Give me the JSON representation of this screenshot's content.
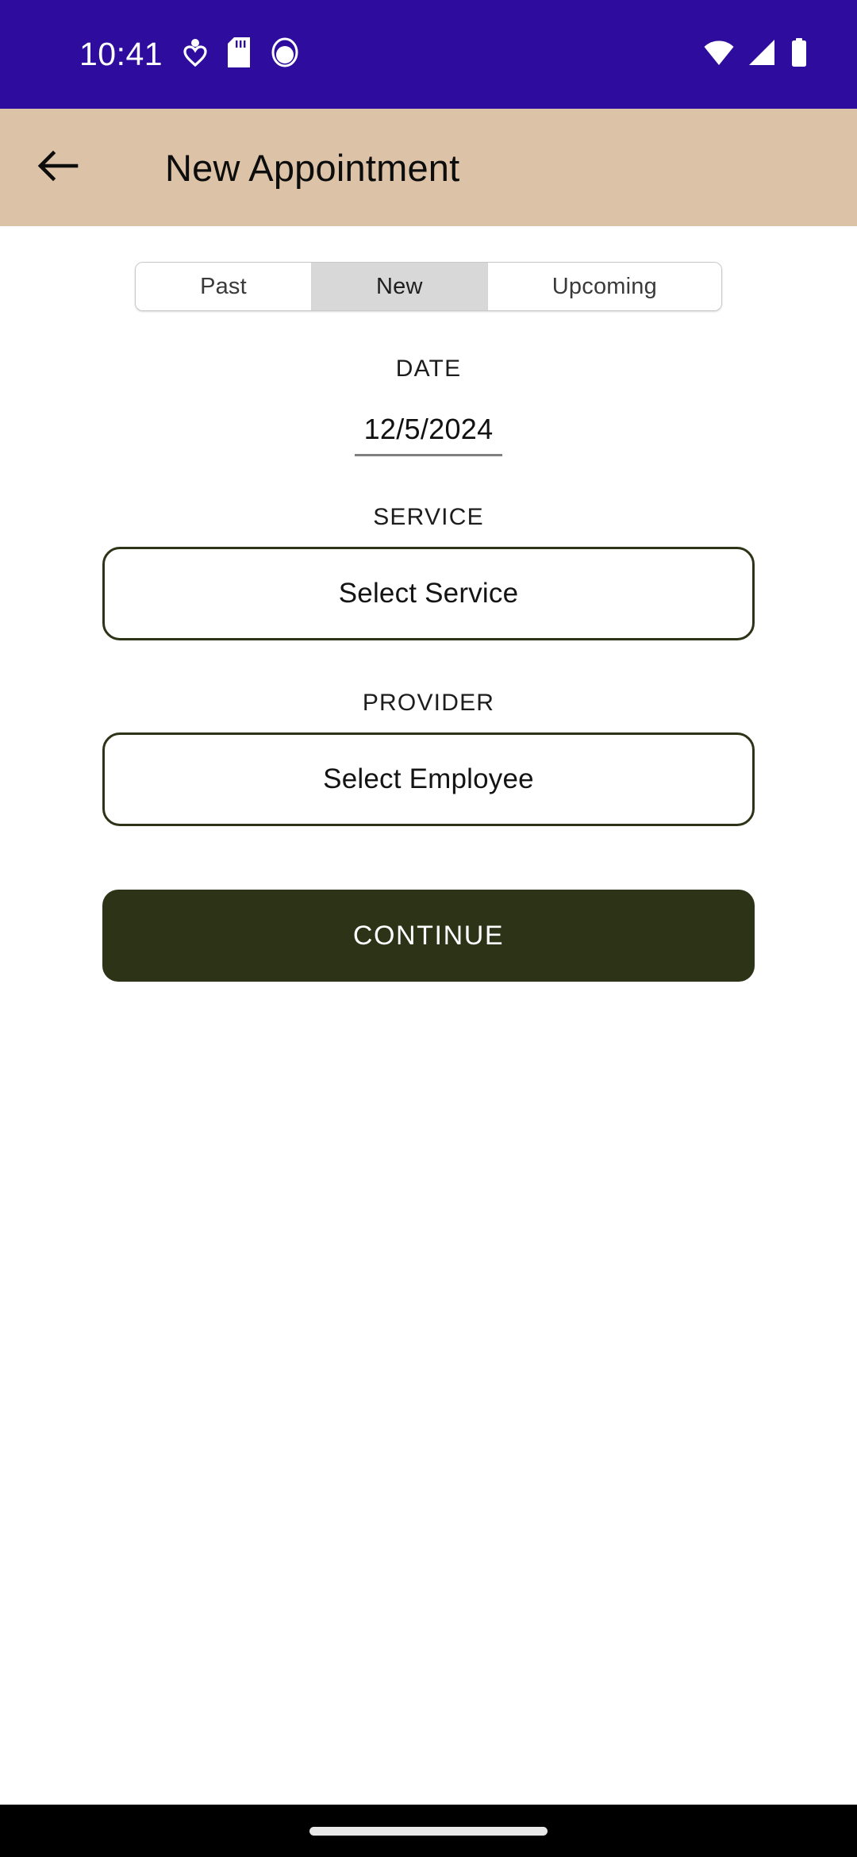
{
  "status_bar": {
    "time": "10:41",
    "background_color": "#2E0D9E",
    "icons": [
      "person-heart-icon",
      "sd-card-icon",
      "face-icon",
      "wifi-icon",
      "cell-signal-icon",
      "battery-icon"
    ]
  },
  "app_bar": {
    "title": "New Appointment",
    "back_icon": "arrow-left-icon",
    "background_color": "#DCC2A6"
  },
  "tabs": {
    "items": [
      {
        "label": "Past",
        "selected": false
      },
      {
        "label": "New",
        "selected": true
      },
      {
        "label": "Upcoming",
        "selected": false
      }
    ],
    "selected_index": 1,
    "selected_background": "#D8D8D8"
  },
  "form": {
    "date": {
      "label": "DATE",
      "value": "12/5/2024"
    },
    "service": {
      "label": "SERVICE",
      "value": "Select Service"
    },
    "provider": {
      "label": "PROVIDER",
      "value": "Select Employee"
    },
    "continue_label": "CONTINUE",
    "accent_color": "#2C3316"
  },
  "nav_bar": {
    "gesture_pill": "home-indicator"
  }
}
